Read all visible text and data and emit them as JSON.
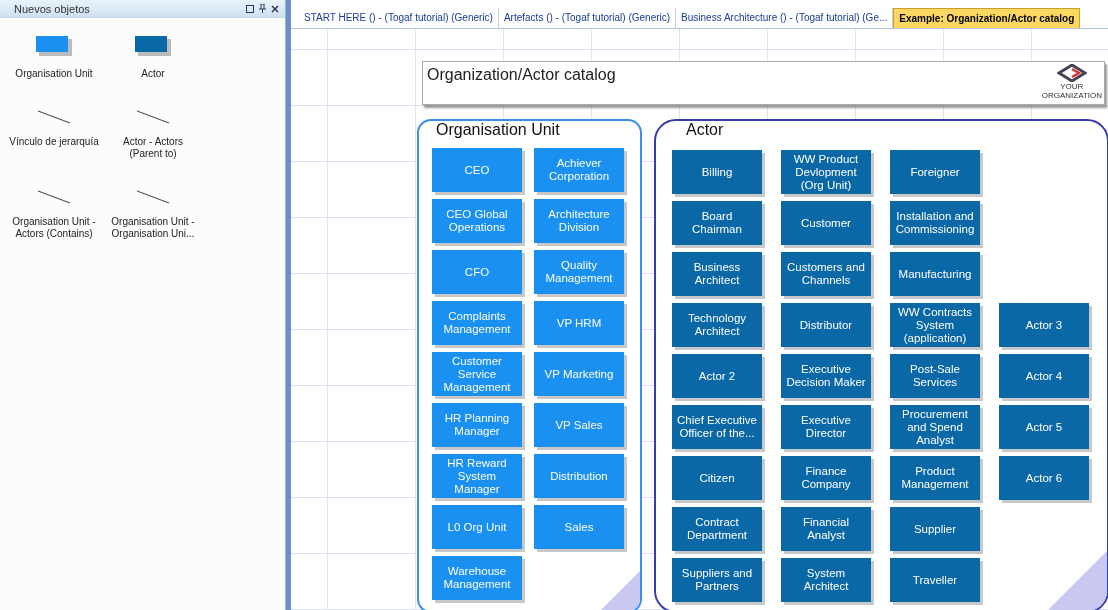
{
  "palette": {
    "title": "Nuevos objetos",
    "items": [
      {
        "kind": "shape",
        "label": "Organisation Unit",
        "color": "#1a90f0"
      },
      {
        "kind": "shape",
        "label": "Actor",
        "color": "#0b68a6"
      },
      {
        "kind": "connector",
        "label": "Vínculo de jerarquía"
      },
      {
        "kind": "connector",
        "label": "Actor - Actors (Parent to)"
      },
      {
        "kind": "connector",
        "label": "Organisation Unit - Actors (Contains)"
      },
      {
        "kind": "connector",
        "label": "Organisation Unit - Organisation Uni..."
      }
    ]
  },
  "tabs": [
    {
      "label": "START HERE () - (Togaf tutorial) (Generic)",
      "selected": false
    },
    {
      "label": "Artefacts () - (Togaf tutorial) (Generic)",
      "selected": false
    },
    {
      "label": "Business Architecture () - (Togaf tutorial) (Ge...",
      "selected": false
    },
    {
      "label": "Example:  Organization/Actor catalog",
      "selected": true
    }
  ],
  "diagram": {
    "title": "Organization/Actor catalog",
    "logo_text": [
      "YOUR",
      "ORGANIZATION"
    ],
    "org_units": {
      "title": "Organisation Unit",
      "rows": [
        [
          "CEO",
          "Achiever Corporation"
        ],
        [
          "CEO Global Operations",
          "Architecture Division"
        ],
        [
          "CFO",
          "Quality Management"
        ],
        [
          "Complaints Management",
          "VP HRM"
        ],
        [
          "Customer Service Management",
          "VP Marketing"
        ],
        [
          "HR Planning Manager",
          "VP Sales"
        ],
        [
          "HR Reward System Manager",
          "Distribution"
        ],
        [
          "L0 Org Unit",
          "Sales"
        ],
        [
          "Warehouse Management"
        ]
      ]
    },
    "actors": {
      "title": "Actor",
      "rows": [
        [
          "Billing",
          "WW Product Devlopment (Org Unit)",
          "Foreigner"
        ],
        [
          "Board Chairman",
          "Customer",
          "Installation and Commissioning"
        ],
        [
          "Business Architect",
          "Customers and Channels",
          "Manufacturing"
        ],
        [
          "Technology Architect",
          "Distributor",
          "WW Contracts System (application)",
          "Actor 3"
        ],
        [
          "Actor 2",
          "Executive Decision Maker",
          "Post-Sale Services",
          "Actor 4"
        ],
        [
          "Chief Executive Officer of the...",
          "Executive Director",
          "Procurement and Spend Analyst",
          "Actor 5"
        ],
        [
          "Citizen",
          "Finance Company",
          "Product Management",
          "Actor 6"
        ],
        [
          "Contract Department",
          "Financial Analyst",
          "Supplier"
        ],
        [
          "Suppliers and Partners",
          "System Architect",
          "Traveller"
        ]
      ]
    }
  }
}
